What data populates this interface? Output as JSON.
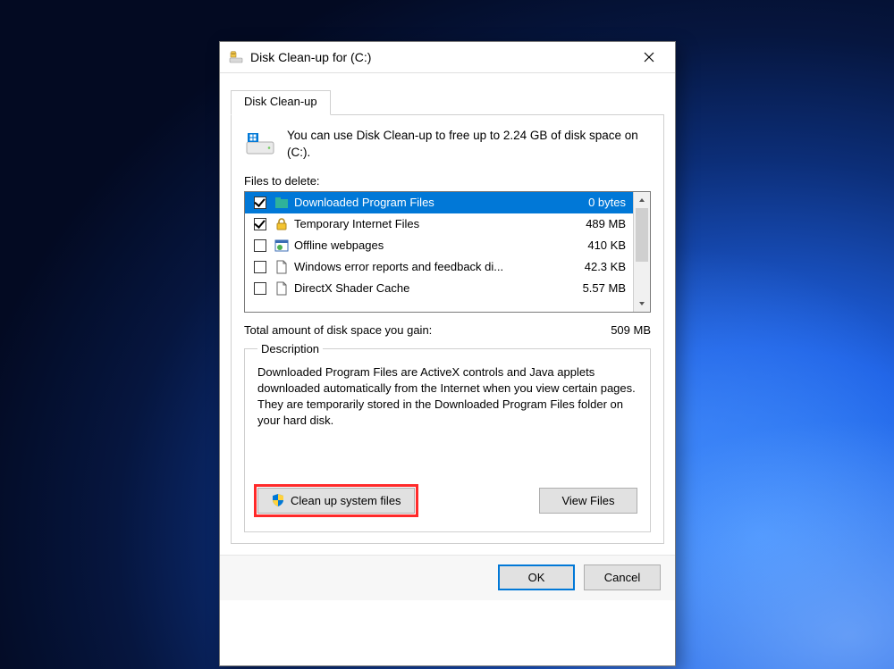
{
  "window": {
    "title": "Disk Clean-up for  (C:)",
    "tab": "Disk Clean-up"
  },
  "info": "You can use Disk Clean-up to free up to 2.24 GB of disk space on  (C:).",
  "files_label": "Files to delete:",
  "files": [
    {
      "name": "Downloaded Program Files",
      "size": "0 bytes",
      "checked": true,
      "selected": true,
      "icon": "folder-teal"
    },
    {
      "name": "Temporary Internet Files",
      "size": "489 MB",
      "checked": true,
      "selected": false,
      "icon": "lock"
    },
    {
      "name": "Offline webpages",
      "size": "410 KB",
      "checked": false,
      "selected": false,
      "icon": "web"
    },
    {
      "name": "Windows error reports and feedback di...",
      "size": "42.3 KB",
      "checked": false,
      "selected": false,
      "icon": "file"
    },
    {
      "name": "DirectX Shader Cache",
      "size": "5.57 MB",
      "checked": false,
      "selected": false,
      "icon": "file"
    }
  ],
  "total": {
    "label": "Total amount of disk space you gain:",
    "value": "509 MB"
  },
  "description": {
    "legend": "Description",
    "text": "Downloaded Program Files are ActiveX controls and Java applets downloaded automatically from the Internet when you view certain pages. They are temporarily stored in the Downloaded Program Files folder on your hard disk."
  },
  "buttons": {
    "sysfiles": "Clean up system files",
    "view": "View Files",
    "ok": "OK",
    "cancel": "Cancel"
  }
}
